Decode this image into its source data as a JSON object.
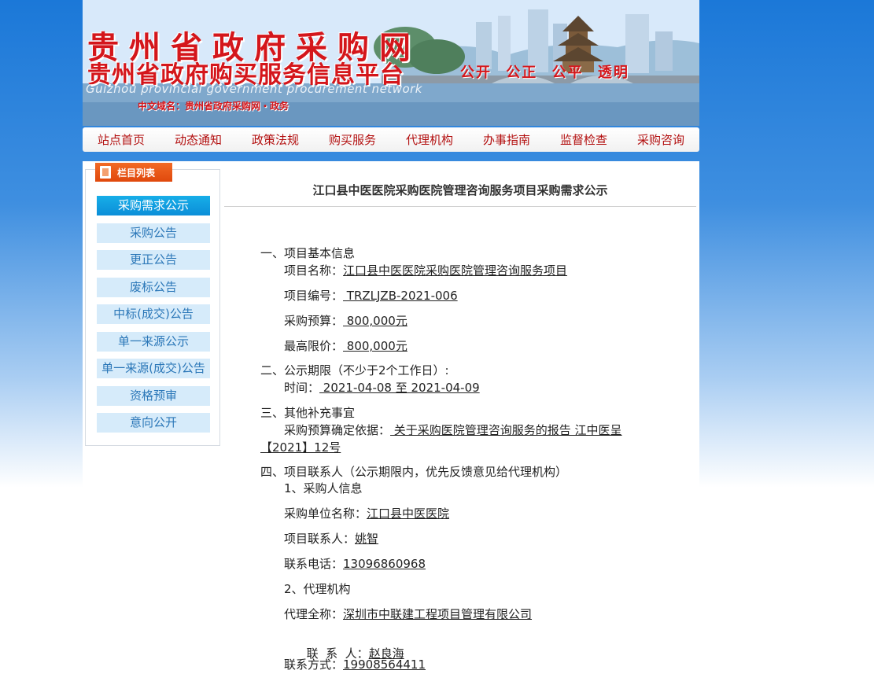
{
  "header": {
    "site_name": "贵州省政府采购网",
    "platform_name": "贵州省政府购买服务信息平台",
    "english_name": "Guizhou provincial government procurement network",
    "domain_line": "中文域名：贵州省政府采购网・政务",
    "slogan": [
      "公开",
      "公正",
      "公平",
      "透明"
    ]
  },
  "nav": [
    "站点首页",
    "动态通知",
    "政策法规",
    "购买服务",
    "代理机构",
    "办事指南",
    "监督检查",
    "采购咨询"
  ],
  "sidebar": {
    "title": "栏目列表",
    "items": [
      {
        "label": "采购需求公示",
        "active": true
      },
      {
        "label": "采购公告"
      },
      {
        "label": "更正公告"
      },
      {
        "label": "废标公告"
      },
      {
        "label": "中标(成交)公告"
      },
      {
        "label": "单一来源公示"
      },
      {
        "label": "单一来源(成交)公告"
      },
      {
        "label": "资格预审"
      },
      {
        "label": "意向公开"
      }
    ]
  },
  "article": {
    "title": "江口县中医医院采购医院管理咨询服务项目采购需求公示",
    "section1": "一、项目基本信息",
    "project_name_label": "项目名称：",
    "project_name": "江口县中医医院采购医院管理咨询服务项目",
    "project_no_label": "项目编号：",
    "project_no": " TRZLJZB-2021-006",
    "budget_label": "采购预算：",
    "budget": " 800,000元",
    "max_price_label": "最高限价：",
    "max_price": " 800,000元",
    "section2": "二、公示期限（不少于2个工作日）:",
    "time_label": "时间：",
    "time_value": " 2021-04-08 至 2021-04-09",
    "section3": "三、其他补充事宜",
    "basis_label": "采购预算确定依据：",
    "basis_value_1": " 关于采购医院管理咨询服务的报告 江中医呈",
    "basis_value_2": "【2021】12号",
    "section4": "四、项目联系人（公示期限内，优先反馈意见给代理机构）",
    "purchaser_heading": "1、采购人信息",
    "purchaser_unit_label": "采购单位名称：",
    "purchaser_unit": "江口县中医医院",
    "contact_label": "项目联系人：",
    "contact": "姚智",
    "phone_label": "联系电话：",
    "phone": "13096860968",
    "agency_heading": "2、代理机构",
    "agency_name_label": "代理全称：",
    "agency_name": "深圳市中联建工程项目管理有限公司",
    "agency_contact_label": "联  系  人：",
    "agency_contact": "赵良海",
    "agency_phone_label": "联系方式：",
    "agency_phone": "19908564411"
  }
}
